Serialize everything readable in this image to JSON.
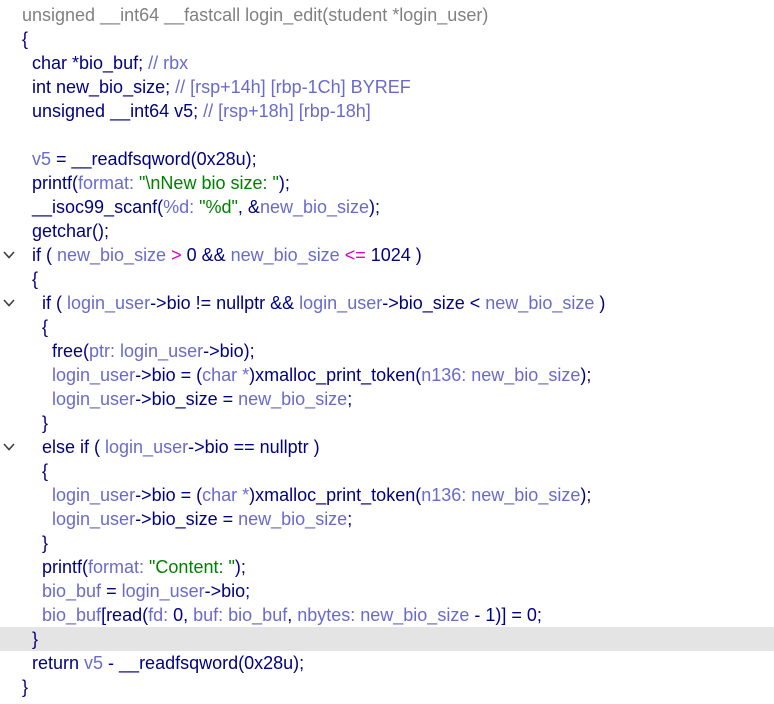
{
  "code": {
    "lines": [
      {
        "fold": false,
        "tokens": [
          {
            "c": "g",
            "t": "unsigned __int64 __fastcall login_edit(student *login_user)"
          }
        ]
      },
      {
        "fold": false,
        "tokens": [
          {
            "c": "n",
            "t": "{"
          }
        ]
      },
      {
        "fold": false,
        "tokens": [
          {
            "c": "n",
            "t": "  char *bio_buf; "
          },
          {
            "c": "v",
            "t": "// rbx"
          }
        ]
      },
      {
        "fold": false,
        "tokens": [
          {
            "c": "n",
            "t": "  int new_bio_size; "
          },
          {
            "c": "v",
            "t": "// [rsp+14h] [rbp-1Ch] BYREF"
          }
        ]
      },
      {
        "fold": false,
        "tokens": [
          {
            "c": "n",
            "t": "  unsigned __int64 v5; "
          },
          {
            "c": "v",
            "t": "// [rsp+18h] [rbp-18h]"
          }
        ]
      },
      {
        "fold": false,
        "tokens": []
      },
      {
        "fold": false,
        "tokens": [
          {
            "c": "v",
            "t": "  v5"
          },
          {
            "c": "n",
            "t": " = __readfsqword(0x28u);"
          }
        ]
      },
      {
        "fold": false,
        "tokens": [
          {
            "c": "n",
            "t": "  printf("
          },
          {
            "c": "v",
            "t": "format: "
          },
          {
            "c": "s",
            "t": "\"\\nNew bio size: \""
          },
          {
            "c": "n",
            "t": ");"
          }
        ]
      },
      {
        "fold": false,
        "tokens": [
          {
            "c": "n",
            "t": "  __isoc99_scanf("
          },
          {
            "c": "v",
            "t": "%d: "
          },
          {
            "c": "s",
            "t": "\"%d\""
          },
          {
            "c": "n",
            "t": ", &"
          },
          {
            "c": "v",
            "t": "new_bio_size"
          },
          {
            "c": "n",
            "t": ");"
          }
        ]
      },
      {
        "fold": false,
        "tokens": [
          {
            "c": "n",
            "t": "  getchar();"
          }
        ]
      },
      {
        "fold": true,
        "tokens": [
          {
            "c": "n",
            "t": "  if ( "
          },
          {
            "c": "v",
            "t": "new_bio_size"
          },
          {
            "c": "m",
            "t": " > "
          },
          {
            "c": "n",
            "t": "0 && "
          },
          {
            "c": "v",
            "t": "new_bio_size"
          },
          {
            "c": "m",
            "t": " <= "
          },
          {
            "c": "n",
            "t": "1024 )"
          }
        ]
      },
      {
        "fold": false,
        "tokens": [
          {
            "c": "n",
            "t": "  {"
          }
        ]
      },
      {
        "fold": true,
        "tokens": [
          {
            "c": "n",
            "t": "    if ( "
          },
          {
            "c": "v",
            "t": "login_user"
          },
          {
            "c": "n",
            "t": "->bio != nullptr && "
          },
          {
            "c": "v",
            "t": "login_user"
          },
          {
            "c": "n",
            "t": "->bio_size < "
          },
          {
            "c": "v",
            "t": "new_bio_size"
          },
          {
            "c": "n",
            "t": " )"
          }
        ]
      },
      {
        "fold": false,
        "tokens": [
          {
            "c": "n",
            "t": "    {"
          }
        ]
      },
      {
        "fold": false,
        "tokens": [
          {
            "c": "n",
            "t": "      free("
          },
          {
            "c": "v",
            "t": "ptr: login_user"
          },
          {
            "c": "n",
            "t": "->bio);"
          }
        ]
      },
      {
        "fold": false,
        "tokens": [
          {
            "c": "v",
            "t": "      login_user"
          },
          {
            "c": "n",
            "t": "->bio = ("
          },
          {
            "c": "v",
            "t": "char *"
          },
          {
            "c": "n",
            "t": ")xmalloc_print_token("
          },
          {
            "c": "v",
            "t": "n136: new_bio_size"
          },
          {
            "c": "n",
            "t": ");"
          }
        ]
      },
      {
        "fold": false,
        "tokens": [
          {
            "c": "v",
            "t": "      login_user"
          },
          {
            "c": "n",
            "t": "->bio_size = "
          },
          {
            "c": "v",
            "t": "new_bio_size"
          },
          {
            "c": "n",
            "t": ";"
          }
        ]
      },
      {
        "fold": false,
        "tokens": [
          {
            "c": "n",
            "t": "    }"
          }
        ]
      },
      {
        "fold": true,
        "tokens": [
          {
            "c": "n",
            "t": "    else if ( "
          },
          {
            "c": "v",
            "t": "login_user"
          },
          {
            "c": "n",
            "t": "->bio == nullptr )"
          }
        ]
      },
      {
        "fold": false,
        "tokens": [
          {
            "c": "n",
            "t": "    {"
          }
        ]
      },
      {
        "fold": false,
        "tokens": [
          {
            "c": "v",
            "t": "      login_user"
          },
          {
            "c": "n",
            "t": "->bio = ("
          },
          {
            "c": "v",
            "t": "char *"
          },
          {
            "c": "n",
            "t": ")xmalloc_print_token("
          },
          {
            "c": "v",
            "t": "n136: new_bio_size"
          },
          {
            "c": "n",
            "t": ");"
          }
        ]
      },
      {
        "fold": false,
        "tokens": [
          {
            "c": "v",
            "t": "      login_user"
          },
          {
            "c": "n",
            "t": "->bio_size = "
          },
          {
            "c": "v",
            "t": "new_bio_size"
          },
          {
            "c": "n",
            "t": ";"
          }
        ]
      },
      {
        "fold": false,
        "tokens": [
          {
            "c": "n",
            "t": "    }"
          }
        ]
      },
      {
        "fold": false,
        "tokens": [
          {
            "c": "n",
            "t": "    printf("
          },
          {
            "c": "v",
            "t": "format: "
          },
          {
            "c": "s",
            "t": "\"Content: \""
          },
          {
            "c": "n",
            "t": ");"
          }
        ]
      },
      {
        "fold": false,
        "tokens": [
          {
            "c": "v",
            "t": "    bio_buf"
          },
          {
            "c": "n",
            "t": " = "
          },
          {
            "c": "v",
            "t": "login_user"
          },
          {
            "c": "n",
            "t": "->bio;"
          }
        ]
      },
      {
        "fold": false,
        "tokens": [
          {
            "c": "v",
            "t": "    bio_buf"
          },
          {
            "c": "n",
            "t": "[read("
          },
          {
            "c": "v",
            "t": "fd: "
          },
          {
            "c": "n",
            "t": "0, "
          },
          {
            "c": "v",
            "t": "buf: bio_buf"
          },
          {
            "c": "n",
            "t": ", "
          },
          {
            "c": "v",
            "t": "nbytes: new_bio_size"
          },
          {
            "c": "n",
            "t": " - 1)] = 0;"
          }
        ]
      },
      {
        "fold": false,
        "highlight": true,
        "tokens": [
          {
            "c": "n",
            "t": "  }"
          }
        ]
      },
      {
        "fold": false,
        "tokens": [
          {
            "c": "n",
            "t": "  return "
          },
          {
            "c": "v",
            "t": "v5"
          },
          {
            "c": "n",
            "t": " - __readfsqword(0x28u);"
          }
        ]
      },
      {
        "fold": false,
        "tokens": [
          {
            "c": "n",
            "t": "}"
          }
        ]
      }
    ]
  }
}
